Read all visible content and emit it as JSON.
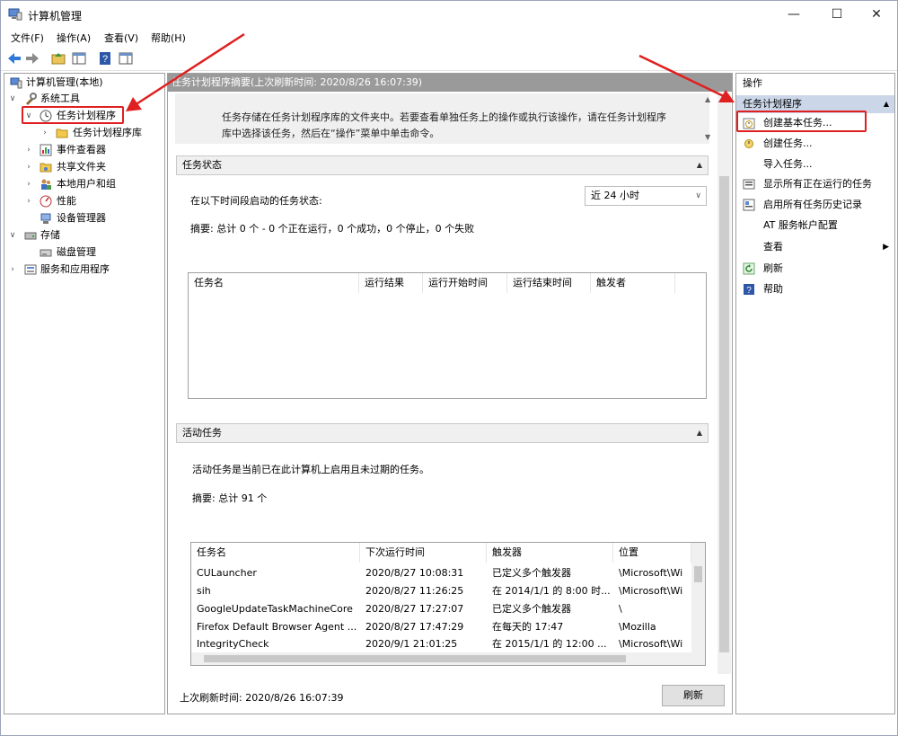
{
  "window": {
    "title": "计算机管理",
    "controls": {
      "minimize": "—",
      "maximize": "☐",
      "close": "✕"
    }
  },
  "menubar": {
    "items": [
      "文件(F)",
      "操作(A)",
      "查看(V)",
      "帮助(H)"
    ]
  },
  "tree": {
    "items": [
      {
        "label": "计算机管理(本地)",
        "expander": "",
        "icon": "computer-management-icon"
      },
      {
        "label": "系统工具",
        "expander": "∨",
        "icon": "tools-icon"
      },
      {
        "label": "任务计划程序",
        "expander": "∨",
        "icon": "clock-icon"
      },
      {
        "label": "任务计划程序库",
        "expander": "›",
        "icon": "folder-icon"
      },
      {
        "label": "事件查看器",
        "expander": "›",
        "icon": "event-viewer-icon"
      },
      {
        "label": "共享文件夹",
        "expander": "›",
        "icon": "shared-folder-icon"
      },
      {
        "label": "本地用户和组",
        "expander": "›",
        "icon": "users-icon"
      },
      {
        "label": "性能",
        "expander": "›",
        "icon": "performance-icon"
      },
      {
        "label": "设备管理器",
        "expander": "",
        "icon": "device-manager-icon"
      },
      {
        "label": "存储",
        "expander": "∨",
        "icon": "storage-icon"
      },
      {
        "label": "磁盘管理",
        "expander": "",
        "icon": "disk-icon"
      },
      {
        "label": "服务和应用程序",
        "expander": "›",
        "icon": "services-icon"
      }
    ]
  },
  "center": {
    "header": "任务计划程序摘要(上次刷新时间: 2020/8/26 16:07:39)",
    "description_line1": "任务存储在任务计划程序库的文件夹中。若要查看单独任务上的操作或执行该操作，请在任务计划程序",
    "description_line2": "库中选择该任务，然后在“操作”菜单中单击命令。",
    "status_section": {
      "title": "任务状态",
      "label": "在以下时间段启动的任务状态:",
      "period": "近 24 小时",
      "summary": "摘要: 总计 0 个 - 0 个正在运行，0 个成功，0 个停止，0 个失败",
      "columns": [
        "任务名",
        "运行结果",
        "运行开始时间",
        "运行结束时间",
        "触发者"
      ]
    },
    "active_section": {
      "title": "活动任务",
      "description": "活动任务是当前已在此计算机上启用且未过期的任务。",
      "summary": "摘要: 总计 91 个",
      "columns": [
        "任务名",
        "下次运行时间",
        "触发器",
        "位置"
      ],
      "rows": [
        [
          "CULauncher",
          "2020/8/27 10:08:31",
          "已定义多个触发器",
          "\\Microsoft\\Wi"
        ],
        [
          "sih",
          "2020/8/27 11:26:25",
          "在 2014/1/1 的 8:00 时...",
          "\\Microsoft\\Wi"
        ],
        [
          "GoogleUpdateTaskMachineCore",
          "2020/8/27 17:27:07",
          "已定义多个触发器",
          "\\"
        ],
        [
          "Firefox Default Browser Agent ...",
          "2020/8/27 17:47:29",
          "在每天的 17:47",
          "\\Mozilla"
        ],
        [
          "IntegrityCheck",
          "2020/9/1 21:01:25",
          "在 2015/1/1 的 12:00 ...",
          "\\Microsoft\\Wi"
        ]
      ]
    },
    "last_refresh": "上次刷新时间: 2020/8/26 16:07:39",
    "refresh_button": "刷新"
  },
  "actions": {
    "header": "操作",
    "section": "任务计划程序",
    "items": [
      {
        "label": "创建基本任务...",
        "icon": "create-basic-task-icon"
      },
      {
        "label": "创建任务...",
        "icon": "create-task-icon"
      },
      {
        "label": "导入任务...",
        "icon": ""
      },
      {
        "label": "显示所有正在运行的任务",
        "icon": "running-tasks-icon"
      },
      {
        "label": "启用所有任务历史记录",
        "icon": "history-icon"
      },
      {
        "label": "AT 服务帐户配置",
        "icon": ""
      },
      {
        "label": "查看",
        "icon": ""
      },
      {
        "label": "刷新",
        "icon": "refresh-icon"
      },
      {
        "label": "帮助",
        "icon": "help-icon"
      }
    ]
  },
  "colors": {
    "annotation_red": "#e02020",
    "header_gray": "#9a9a9a",
    "section_blue": "#cbd7e8"
  }
}
